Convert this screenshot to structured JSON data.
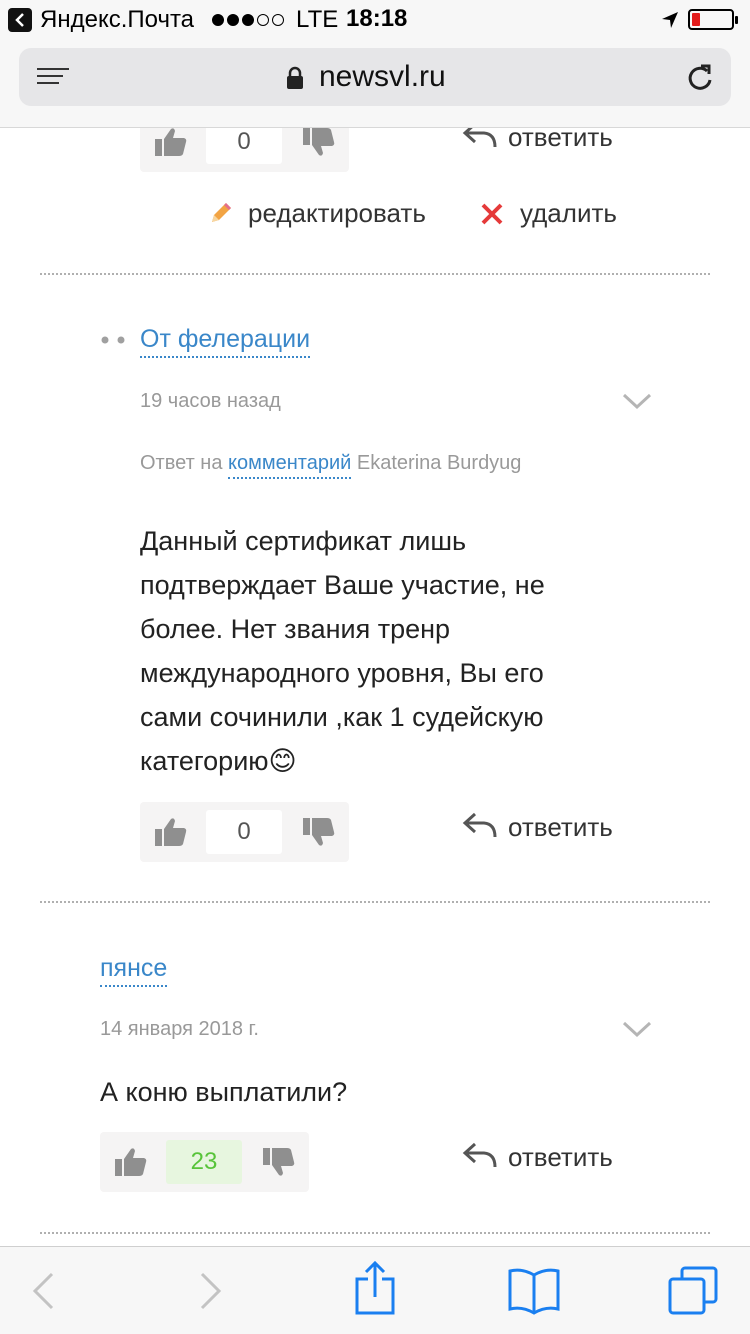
{
  "statusbar": {
    "back_app": "Яндекс.Почта",
    "signal_dots": 3,
    "signal_total": 5,
    "carrier": "LTE",
    "time": "18:18",
    "battery_level": 0.12,
    "battery_color": "#e21b1b"
  },
  "browser": {
    "domain": "newsvl.ru"
  },
  "top_comment": {
    "votes": "0",
    "reply_label": "ответить",
    "edit_label": "редактировать",
    "delete_label": "удалить"
  },
  "comments": [
    {
      "author": "От фелерации",
      "time": "19 часов назад",
      "reply_prefix": "Ответ на",
      "reply_link": "комментарий",
      "reply_to": "Ekaterina Burdyug",
      "text_lines": [
        "Данный сертификат лишь",
        "подтверждает Ваше участие, не",
        "более. Нет звания тренр",
        "международного уровня, Вы его",
        "сами сочинили ,как 1 судейскую",
        "категорию😊"
      ],
      "votes": "0",
      "reply_label": "ответить"
    },
    {
      "author": "пянсе",
      "time": "14 января 2018 г.",
      "text": "А коню выплатили?",
      "votes": "23",
      "reply_label": "ответить"
    }
  ],
  "colors": {
    "link": "#3a87c9",
    "positive": "#58c43a",
    "accent_browser": "#1a7ff0"
  }
}
